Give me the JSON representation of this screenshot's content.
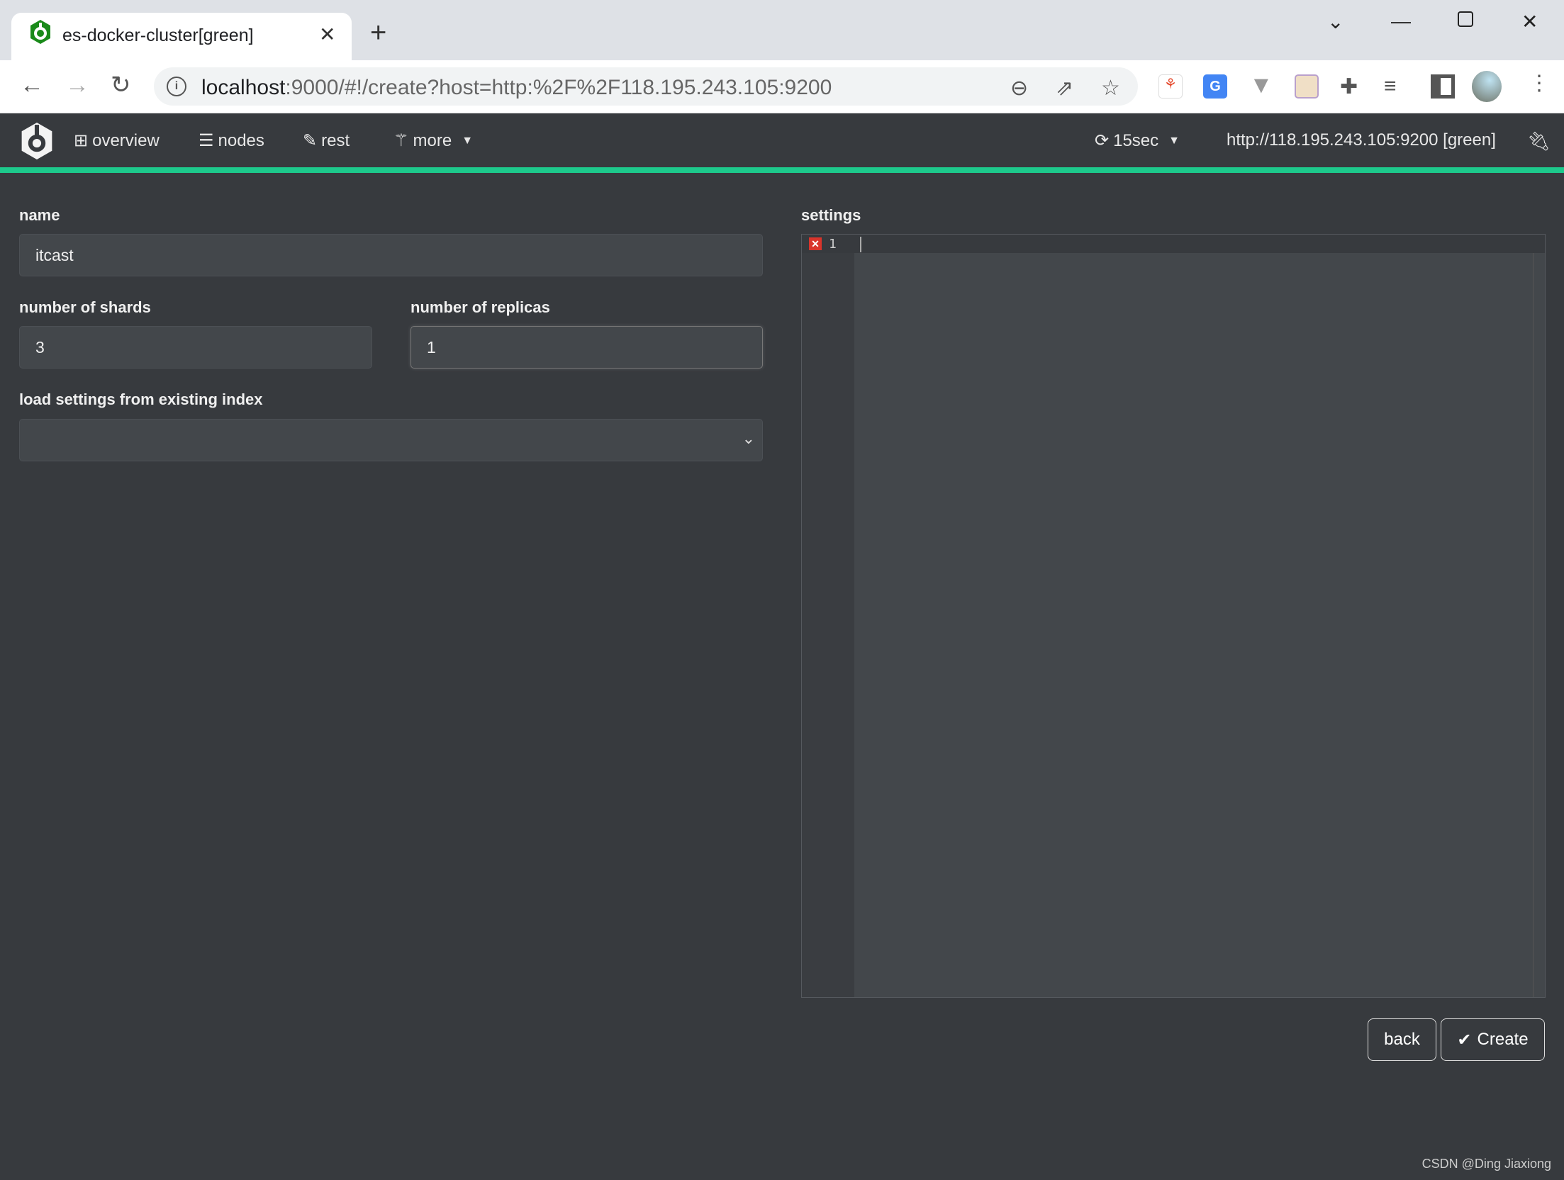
{
  "browser": {
    "tab_title": "es-docker-cluster[green]",
    "url_host": "localhost",
    "url_rest": ":9000/#!/create?host=http:%2F%2F118.195.243.105:9200"
  },
  "nav": {
    "items": [
      {
        "label": "overview",
        "icon": "sitemap-icon"
      },
      {
        "label": "nodes",
        "icon": "server-icon"
      },
      {
        "label": "rest",
        "icon": "edit-icon"
      },
      {
        "label": "more",
        "icon": "magic-wand-icon"
      }
    ],
    "refresh": "15sec",
    "cluster": "http://118.195.243.105:9200 [green]",
    "status_color": "#1dc98c"
  },
  "form": {
    "name_label": "name",
    "name_value": "itcast",
    "shards_label": "number of shards",
    "shards_value": "3",
    "replicas_label": "number of replicas",
    "replicas_value": "1",
    "load_label": "load settings from existing index",
    "load_value": ""
  },
  "settings": {
    "label": "settings",
    "line_number": "1"
  },
  "buttons": {
    "back": "back",
    "create": "Create"
  },
  "watermark": "CSDN @Ding Jiaxiong"
}
